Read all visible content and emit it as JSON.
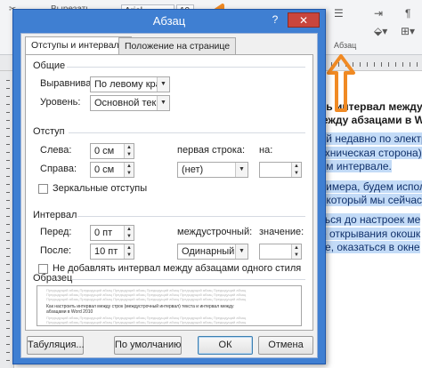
{
  "background": {
    "ribbon": {
      "cut_label": "Вырезать",
      "font_name": "Arial",
      "font_size": "10",
      "paragraph_group_label": "Абзац"
    },
    "document_lines": [
      {
        "text": "ить интервал между",
        "style": "bold"
      },
      {
        "text": "между абзацами в W",
        "style": "bold"
      },
      {
        "text": "ней недавно по электро",
        "style": "hl"
      },
      {
        "text": "техническая сторона)",
        "style": "hl"
      },
      {
        "text": "ном интервале.",
        "style": "hl"
      },
      {
        "text": "примера, будем испол",
        "style": "hl"
      },
      {
        "text": "а, который мы сейчас",
        "style": "hl"
      },
      {
        "text": "аться до настроек ме",
        "style": "hl"
      },
      {
        "text": "де открывания окошк",
        "style": "hl"
      },
      {
        "text": "ёте, оказаться в окне",
        "style": "hl"
      }
    ],
    "accent_color": "#f08a24"
  },
  "dialog": {
    "title": "Абзац",
    "help_label": "?",
    "close_label": "✕",
    "tabs": [
      {
        "label": "Отступы и интервалы",
        "active": true
      },
      {
        "label": "Положение на странице",
        "active": false
      }
    ],
    "general": {
      "heading": "Общие",
      "alignment_label": "Выравнивание:",
      "alignment_value": "По левому краю",
      "level_label": "Уровень:",
      "level_value": "Основной текст"
    },
    "indent": {
      "heading": "Отступ",
      "left_label": "Слева:",
      "left_value": "0 см",
      "right_label": "Справа:",
      "right_value": "0 см",
      "first_line_label": "первая строка:",
      "first_line_value": "(нет)",
      "by_label": "на:",
      "by_value": "",
      "mirror_label": "Зеркальные отступы",
      "mirror_checked": false
    },
    "spacing": {
      "heading": "Интервал",
      "before_label": "Перед:",
      "before_value": "0 пт",
      "after_label": "После:",
      "after_value": "10 пт",
      "line_label": "междустрочный:",
      "line_value": "Одинарный",
      "at_label": "значение:",
      "at_value": "",
      "no_space_label": "Не добавлять интервал между абзацами одного стиля",
      "no_space_checked": false
    },
    "preview": {
      "heading": "Образец",
      "sample_text_1": "Как настроить интервал между строк (междустрочный интервал) текста и интервал между",
      "sample_text_2": "абзацами в Word 2010",
      "grey_text": "Предыдущий абзац Предыдущий абзац Предыдущий абзац Предыдущий абзац Предыдущий абзац Предыдущий абзац"
    },
    "buttons": {
      "tabs_label": "Табуляция...",
      "default_label": "По умолчанию",
      "ok_label": "ОК",
      "cancel_label": "Отмена"
    }
  }
}
